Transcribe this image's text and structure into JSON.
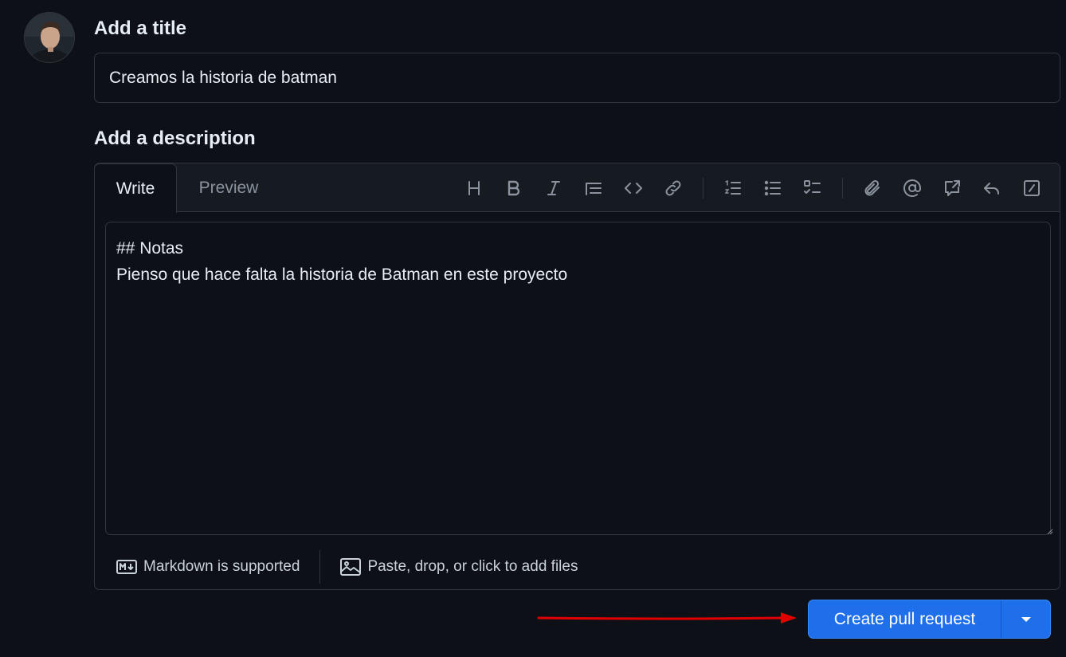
{
  "title_section": {
    "label": "Add a title",
    "value": "Creamos la historia de batman"
  },
  "description_section": {
    "label": "Add a description",
    "tabs": [
      {
        "label": "Write",
        "active": true
      },
      {
        "label": "Preview",
        "active": false
      }
    ],
    "toolbar_icons": [
      "heading-icon",
      "bold-icon",
      "italic-icon",
      "quote-icon",
      "code-icon",
      "link-icon",
      "ordered-list-icon",
      "unordered-list-icon",
      "task-list-icon",
      "attach-icon",
      "mention-icon",
      "cross-reference-icon",
      "reply-icon",
      "slash-commands-icon"
    ],
    "body_text": "## Notas\nPienso que hace falta la historia de Batman en este proyecto",
    "footer": {
      "markdown_label": "Markdown is supported",
      "attach_label": "Paste, drop, or click to add files"
    }
  },
  "actions": {
    "create_pr_label": "Create pull request"
  },
  "colors": {
    "background": "#0d1117",
    "border": "#30363d",
    "primary_button": "#1f6feb",
    "annotation_arrow": "#e00000"
  }
}
